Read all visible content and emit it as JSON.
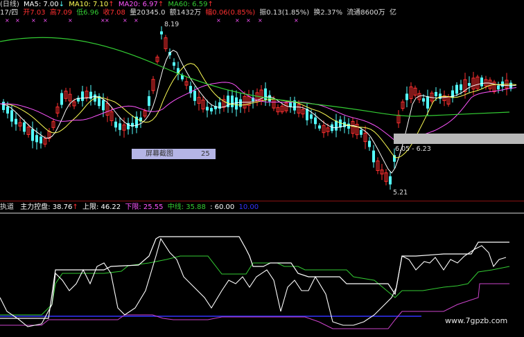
{
  "header": {
    "chart_name": "(日线)",
    "ma5": "MA5: 7.00",
    "ma5_arrow": "↓",
    "ma10": "MA10: 7.10",
    "ma10_arrow": "↑",
    "ma20": "MA20: 6.97",
    "ma20_arrow": "↑",
    "ma60": "MA60: 6.59",
    "ma60_arrow": "↑"
  },
  "info": {
    "date": "17/四",
    "open": "开7.03",
    "high": "高7.09",
    "low": "低6.96",
    "close": "收7.08",
    "volume": "量20345.0",
    "amount": "额1432万",
    "change": "幅0.06(0.85%)",
    "amplitude": "振0.13(1.85%)",
    "turnover": "换2.37%",
    "float": "流通8600万",
    "tail": "亿"
  },
  "stars": "× × × × × × × × × × ×",
  "annotations": {
    "high_price": "8.19",
    "low_price": "5.21",
    "range_label": "6.05 - 6.23",
    "selection_text": "屏幕截图",
    "selection_num": "25"
  },
  "indicator": {
    "name": "执道",
    "main": "主力控盘: 38.76",
    "main_arrow": "↑",
    "upper": "上限: 46.22",
    "lower": "下限: 25.55",
    "middle": "中线: 35.88",
    "sixty": ": 60.00",
    "ten": "10.00"
  },
  "watermark": "www.7gpzb.com",
  "colors": {
    "up": "#ff3030",
    "down": "#54ffff",
    "ma5": "#ffffff",
    "ma10": "#ffff55",
    "ma20": "#ff55ff",
    "ma60": "#33cc33",
    "main_line": "#ffffff",
    "upper_line": "#ffffff",
    "middle_line": "#33cc33",
    "lower_line": "#cc44cc",
    "ten_line": "#3333ff",
    "separator": "#8a1212"
  }
}
